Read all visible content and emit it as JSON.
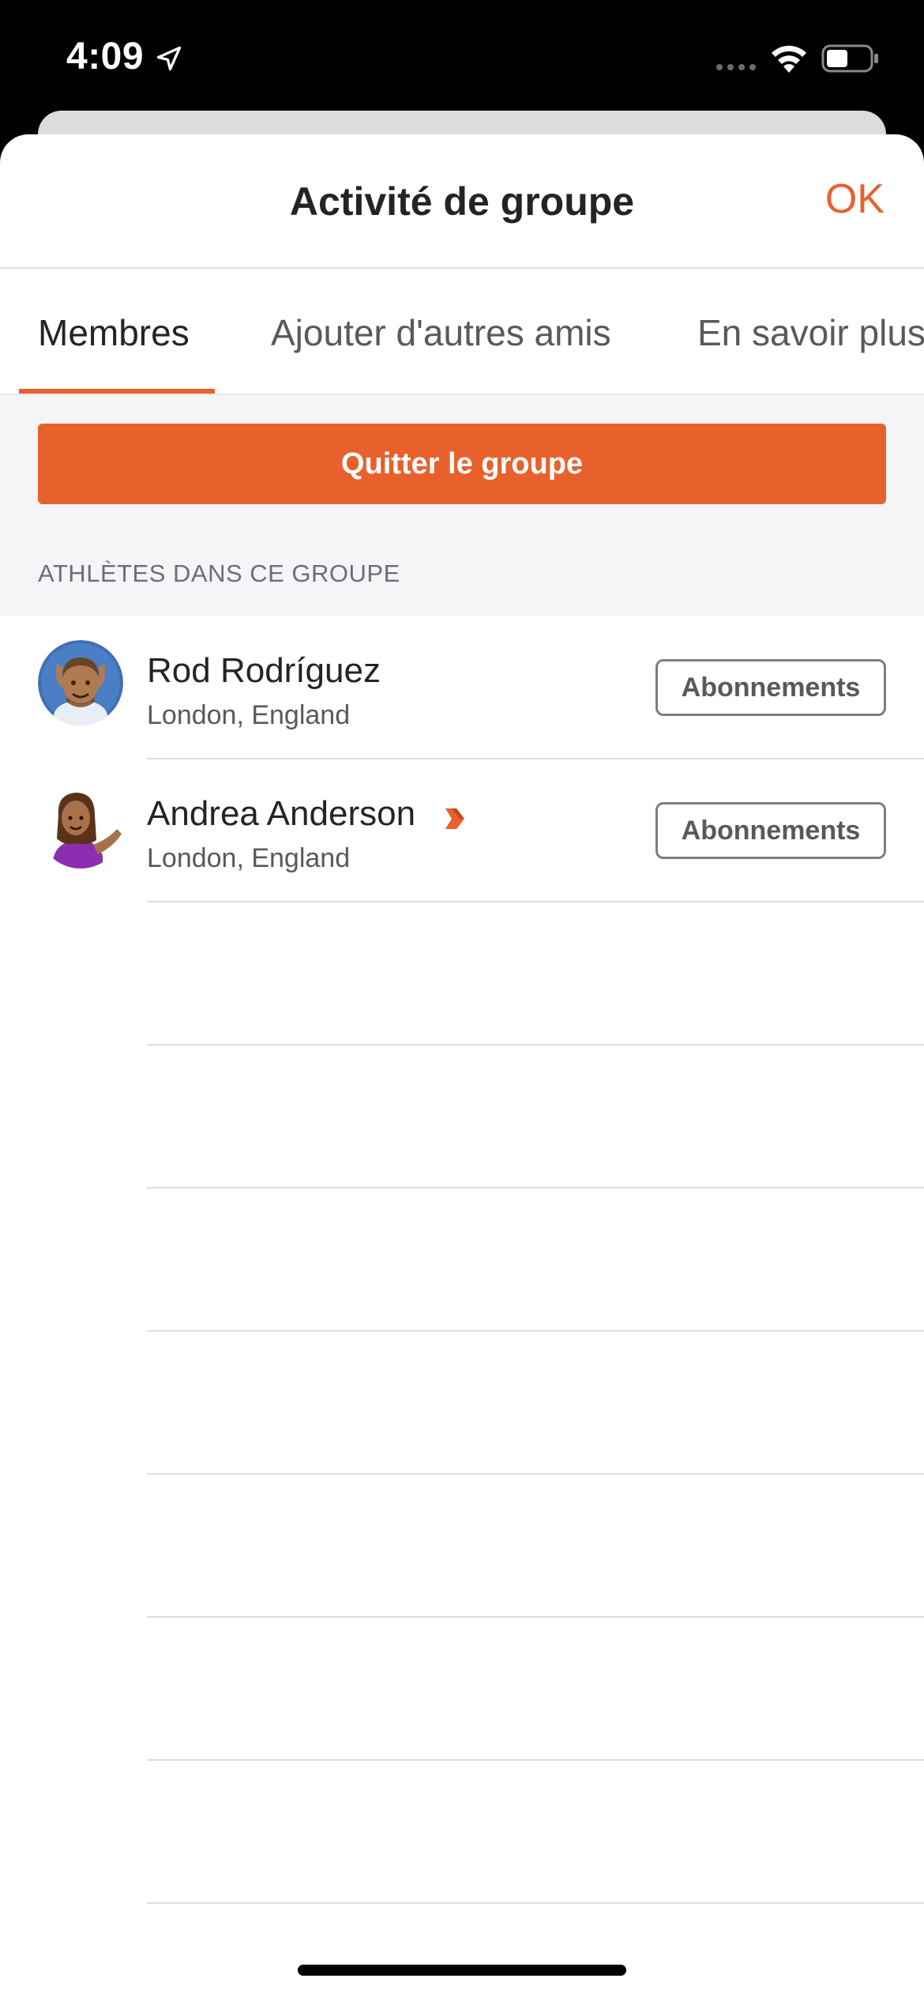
{
  "status_bar": {
    "time": "4:09"
  },
  "header": {
    "title": "Activité de groupe",
    "ok_label": "OK"
  },
  "tabs": [
    {
      "label": "Membres",
      "active": true
    },
    {
      "label": "Ajouter d'autres amis",
      "active": false
    },
    {
      "label": "En savoir plus",
      "active": false
    }
  ],
  "actions": {
    "leave_label": "Quitter le groupe"
  },
  "section": {
    "title": "ATHLÈTES DANS CE GROUPE"
  },
  "athletes": [
    {
      "name": "Rod Rodríguez",
      "location": "London, England",
      "button": "Abonnements",
      "subscriber": false
    },
    {
      "name": "Andrea Anderson",
      "location": "London, England",
      "button": "Abonnements",
      "subscriber": true
    }
  ],
  "colors": {
    "accent": "#e8612c",
    "text": "#242428",
    "secondary": "#58585f"
  }
}
